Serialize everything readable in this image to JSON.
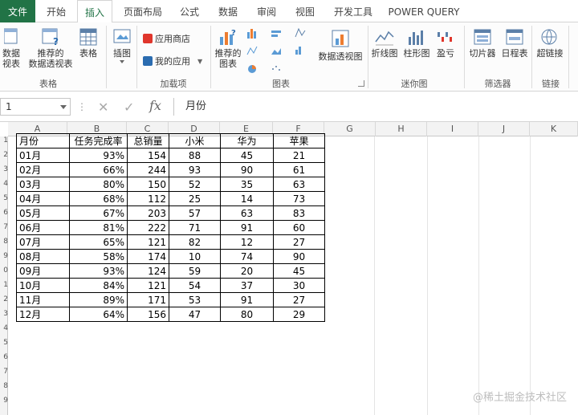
{
  "tabs": [
    {
      "label": "文件"
    },
    {
      "label": "开始"
    },
    {
      "label": "插入"
    },
    {
      "label": "页面布局"
    },
    {
      "label": "公式"
    },
    {
      "label": "数据"
    },
    {
      "label": "审阅"
    },
    {
      "label": "视图"
    },
    {
      "label": "开发工具"
    },
    {
      "label": "POWER QUERY"
    }
  ],
  "ribbon": {
    "tables_group": {
      "pivot_partial": "数据\n视表",
      "recommended_pivot": "推荐的\n数据透视表",
      "table": "表格",
      "label": "表格"
    },
    "illustrations": {
      "label": "插图"
    },
    "addins": {
      "store": "应用商店",
      "my_apps": "我的应用",
      "label": "加载项"
    },
    "charts": {
      "recommended": "推荐的\n图表",
      "pivot_chart": "数据透视图",
      "label": "图表"
    },
    "sparklines": {
      "line": "折线图",
      "column": "柱形图",
      "winloss": "盈亏",
      "label": "迷你图"
    },
    "filters": {
      "slicer": "切片器",
      "timeline": "日程表",
      "label": "筛选器"
    },
    "links": {
      "hyperlink": "超链接",
      "label": "链接"
    }
  },
  "formula_bar": {
    "name_box": "1",
    "fx": "fx",
    "content": "月份"
  },
  "columns": [
    "A",
    "B",
    "C",
    "D",
    "E",
    "F",
    "G",
    "H",
    "I",
    "J",
    "K"
  ],
  "rows": [
    "1",
    "2",
    "3",
    "4",
    "5",
    "6",
    "7",
    "8",
    "9",
    "0",
    "1",
    "2",
    "3",
    "4",
    "5",
    "6",
    "7",
    "8",
    "9",
    "0"
  ],
  "table": {
    "headers": [
      "月份",
      "任务完成率",
      "总销量",
      "小米",
      "华为",
      "苹果"
    ],
    "rows": [
      [
        "01月",
        "93%",
        "154",
        "88",
        "45",
        "21"
      ],
      [
        "02月",
        "66%",
        "244",
        "93",
        "90",
        "61"
      ],
      [
        "03月",
        "80%",
        "150",
        "52",
        "35",
        "63"
      ],
      [
        "04月",
        "68%",
        "112",
        "25",
        "14",
        "73"
      ],
      [
        "05月",
        "67%",
        "203",
        "57",
        "63",
        "83"
      ],
      [
        "06月",
        "81%",
        "222",
        "71",
        "91",
        "60"
      ],
      [
        "07月",
        "65%",
        "121",
        "82",
        "12",
        "27"
      ],
      [
        "08月",
        "58%",
        "174",
        "10",
        "74",
        "90"
      ],
      [
        "09月",
        "93%",
        "124",
        "59",
        "20",
        "45"
      ],
      [
        "10月",
        "84%",
        "121",
        "54",
        "37",
        "30"
      ],
      [
        "11月",
        "89%",
        "171",
        "53",
        "91",
        "27"
      ],
      [
        "12月",
        "64%",
        "156",
        "47",
        "80",
        "29"
      ]
    ]
  },
  "watermark": "@稀土掘金技术社区",
  "colors": {
    "excel_green": "#217346"
  }
}
